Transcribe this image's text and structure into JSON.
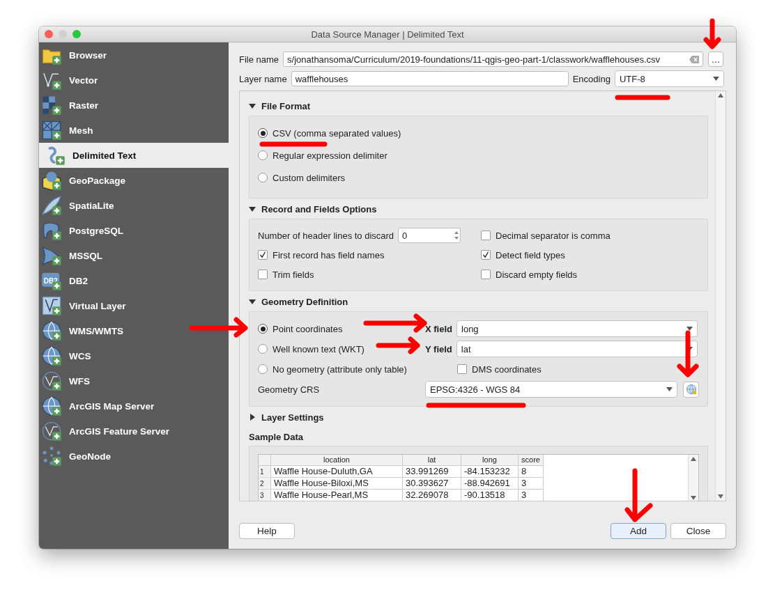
{
  "window": {
    "title": "Data Source Manager | Delimited Text"
  },
  "sidebar": {
    "items": [
      {
        "label": "Browser",
        "kind": "folder",
        "selected": false
      },
      {
        "label": "Vector",
        "kind": "polyline",
        "selected": false
      },
      {
        "label": "Raster",
        "kind": "checker",
        "selected": false
      },
      {
        "label": "Mesh",
        "kind": "mesh",
        "selected": false
      },
      {
        "label": "Delimited Text",
        "kind": "comma",
        "selected": true
      },
      {
        "label": "GeoPackage",
        "kind": "cube",
        "selected": false
      },
      {
        "label": "SpatiaLite",
        "kind": "feather",
        "selected": false
      },
      {
        "label": "PostgreSQL",
        "kind": "elephant",
        "selected": false
      },
      {
        "label": "MSSQL",
        "kind": "sail",
        "selected": false
      },
      {
        "label": "DB2",
        "kind": "textbadge",
        "icon_text": "DB2",
        "selected": false
      },
      {
        "label": "Virtual Layer",
        "kind": "boxpolyline",
        "selected": false
      },
      {
        "label": "WMS/WMTS",
        "kind": "globe",
        "selected": false
      },
      {
        "label": "WCS",
        "kind": "globe",
        "selected": false
      },
      {
        "label": "WFS",
        "kind": "globepolyline",
        "selected": false
      },
      {
        "label": "ArcGIS Map Server",
        "kind": "globe",
        "selected": false
      },
      {
        "label": "ArcGIS Feature Server",
        "kind": "globepolyline",
        "selected": false
      },
      {
        "label": "GeoNode",
        "kind": "dots",
        "selected": false
      }
    ]
  },
  "file_name": {
    "label": "File name",
    "value": "s/jonathansoma/Curriculum/2019-foundations/11-qgis-geo-part-1/classwork/wafflehouses.csv",
    "browse_button": "…"
  },
  "layer_name": {
    "label": "Layer name",
    "value": "wafflehouses"
  },
  "encoding": {
    "label": "Encoding",
    "value": "UTF-8"
  },
  "file_format": {
    "title": "File Format",
    "expanded": true,
    "options": [
      {
        "label": "CSV (comma separated values)",
        "selected": true
      },
      {
        "label": "Regular expression delimiter",
        "selected": false
      },
      {
        "label": "Custom delimiters",
        "selected": false
      }
    ]
  },
  "record_options": {
    "title": "Record and Fields Options",
    "expanded": true,
    "header_lines": {
      "label": "Number of header lines to discard",
      "value": "0"
    },
    "checkboxes": [
      {
        "label": "Decimal separator is comma",
        "checked": false
      },
      {
        "label": "First record has field names",
        "checked": true
      },
      {
        "label": "Detect field types",
        "checked": true
      },
      {
        "label": "Trim fields",
        "checked": false
      },
      {
        "label": "Discard empty fields",
        "checked": false
      }
    ]
  },
  "geometry": {
    "title": "Geometry Definition",
    "expanded": true,
    "options": [
      {
        "label": "Point coordinates",
        "selected": true
      },
      {
        "label": "Well known text (WKT)",
        "selected": false
      },
      {
        "label": "No geometry (attribute only table)",
        "selected": false
      }
    ],
    "x_field": {
      "label": "X field",
      "value": "long"
    },
    "y_field": {
      "label": "Y field",
      "value": "lat"
    },
    "dms": {
      "label": "DMS coordinates",
      "checked": false
    },
    "crs": {
      "label": "Geometry CRS",
      "value": "EPSG:4326 - WGS 84"
    }
  },
  "layer_settings": {
    "title": "Layer Settings",
    "expanded": false
  },
  "sample_data": {
    "title": "Sample Data",
    "columns": [
      "location",
      "lat",
      "long",
      "score"
    ],
    "rows": [
      {
        "index": "1",
        "cells": [
          "Waffle House-Duluth,GA",
          "33.991269",
          "-84.153232",
          "8"
        ]
      },
      {
        "index": "2",
        "cells": [
          "Waffle House-Biloxi,MS",
          "30.393627",
          "-88.942691",
          "3"
        ]
      },
      {
        "index": "3",
        "cells": [
          "Waffle House-Pearl,MS",
          "32.269078",
          "-90.13518",
          "3"
        ]
      }
    ]
  },
  "buttons": [
    {
      "label": "Help",
      "default": false
    },
    {
      "label": "Add",
      "default": true
    },
    {
      "label": "Close",
      "default": false
    }
  ]
}
